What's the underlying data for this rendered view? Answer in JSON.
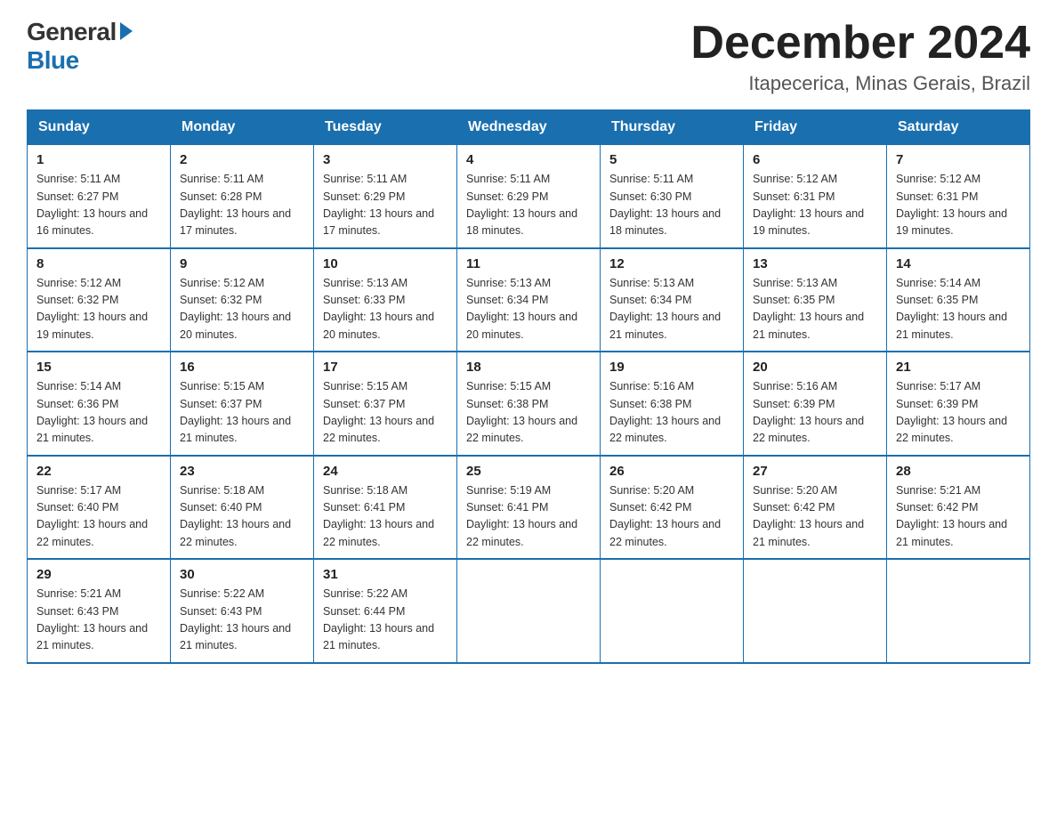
{
  "header": {
    "logo_general": "General",
    "logo_blue": "Blue",
    "month_title": "December 2024",
    "location": "Itapecerica, Minas Gerais, Brazil"
  },
  "weekdays": [
    "Sunday",
    "Monday",
    "Tuesday",
    "Wednesday",
    "Thursday",
    "Friday",
    "Saturday"
  ],
  "weeks": [
    [
      {
        "day": "1",
        "sunrise": "5:11 AM",
        "sunset": "6:27 PM",
        "daylight": "13 hours and 16 minutes."
      },
      {
        "day": "2",
        "sunrise": "5:11 AM",
        "sunset": "6:28 PM",
        "daylight": "13 hours and 17 minutes."
      },
      {
        "day": "3",
        "sunrise": "5:11 AM",
        "sunset": "6:29 PM",
        "daylight": "13 hours and 17 minutes."
      },
      {
        "day": "4",
        "sunrise": "5:11 AM",
        "sunset": "6:29 PM",
        "daylight": "13 hours and 18 minutes."
      },
      {
        "day": "5",
        "sunrise": "5:11 AM",
        "sunset": "6:30 PM",
        "daylight": "13 hours and 18 minutes."
      },
      {
        "day": "6",
        "sunrise": "5:12 AM",
        "sunset": "6:31 PM",
        "daylight": "13 hours and 19 minutes."
      },
      {
        "day": "7",
        "sunrise": "5:12 AM",
        "sunset": "6:31 PM",
        "daylight": "13 hours and 19 minutes."
      }
    ],
    [
      {
        "day": "8",
        "sunrise": "5:12 AM",
        "sunset": "6:32 PM",
        "daylight": "13 hours and 19 minutes."
      },
      {
        "day": "9",
        "sunrise": "5:12 AM",
        "sunset": "6:32 PM",
        "daylight": "13 hours and 20 minutes."
      },
      {
        "day": "10",
        "sunrise": "5:13 AM",
        "sunset": "6:33 PM",
        "daylight": "13 hours and 20 minutes."
      },
      {
        "day": "11",
        "sunrise": "5:13 AM",
        "sunset": "6:34 PM",
        "daylight": "13 hours and 20 minutes."
      },
      {
        "day": "12",
        "sunrise": "5:13 AM",
        "sunset": "6:34 PM",
        "daylight": "13 hours and 21 minutes."
      },
      {
        "day": "13",
        "sunrise": "5:13 AM",
        "sunset": "6:35 PM",
        "daylight": "13 hours and 21 minutes."
      },
      {
        "day": "14",
        "sunrise": "5:14 AM",
        "sunset": "6:35 PM",
        "daylight": "13 hours and 21 minutes."
      }
    ],
    [
      {
        "day": "15",
        "sunrise": "5:14 AM",
        "sunset": "6:36 PM",
        "daylight": "13 hours and 21 minutes."
      },
      {
        "day": "16",
        "sunrise": "5:15 AM",
        "sunset": "6:37 PM",
        "daylight": "13 hours and 21 minutes."
      },
      {
        "day": "17",
        "sunrise": "5:15 AM",
        "sunset": "6:37 PM",
        "daylight": "13 hours and 22 minutes."
      },
      {
        "day": "18",
        "sunrise": "5:15 AM",
        "sunset": "6:38 PM",
        "daylight": "13 hours and 22 minutes."
      },
      {
        "day": "19",
        "sunrise": "5:16 AM",
        "sunset": "6:38 PM",
        "daylight": "13 hours and 22 minutes."
      },
      {
        "day": "20",
        "sunrise": "5:16 AM",
        "sunset": "6:39 PM",
        "daylight": "13 hours and 22 minutes."
      },
      {
        "day": "21",
        "sunrise": "5:17 AM",
        "sunset": "6:39 PM",
        "daylight": "13 hours and 22 minutes."
      }
    ],
    [
      {
        "day": "22",
        "sunrise": "5:17 AM",
        "sunset": "6:40 PM",
        "daylight": "13 hours and 22 minutes."
      },
      {
        "day": "23",
        "sunrise": "5:18 AM",
        "sunset": "6:40 PM",
        "daylight": "13 hours and 22 minutes."
      },
      {
        "day": "24",
        "sunrise": "5:18 AM",
        "sunset": "6:41 PM",
        "daylight": "13 hours and 22 minutes."
      },
      {
        "day": "25",
        "sunrise": "5:19 AM",
        "sunset": "6:41 PM",
        "daylight": "13 hours and 22 minutes."
      },
      {
        "day": "26",
        "sunrise": "5:20 AM",
        "sunset": "6:42 PM",
        "daylight": "13 hours and 22 minutes."
      },
      {
        "day": "27",
        "sunrise": "5:20 AM",
        "sunset": "6:42 PM",
        "daylight": "13 hours and 21 minutes."
      },
      {
        "day": "28",
        "sunrise": "5:21 AM",
        "sunset": "6:42 PM",
        "daylight": "13 hours and 21 minutes."
      }
    ],
    [
      {
        "day": "29",
        "sunrise": "5:21 AM",
        "sunset": "6:43 PM",
        "daylight": "13 hours and 21 minutes."
      },
      {
        "day": "30",
        "sunrise": "5:22 AM",
        "sunset": "6:43 PM",
        "daylight": "13 hours and 21 minutes."
      },
      {
        "day": "31",
        "sunrise": "5:22 AM",
        "sunset": "6:44 PM",
        "daylight": "13 hours and 21 minutes."
      },
      null,
      null,
      null,
      null
    ]
  ]
}
